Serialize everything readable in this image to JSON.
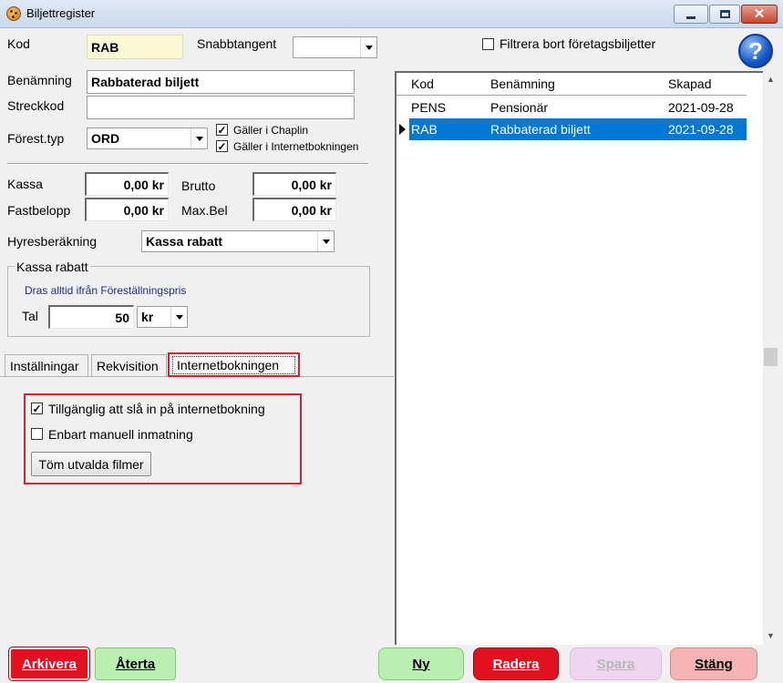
{
  "window": {
    "title": "Biljettregister"
  },
  "form": {
    "kod_label": "Kod",
    "kod_value": "RAB",
    "snabbtangent_label": "Snabbtangent",
    "snabbtangent_value": "",
    "filter_label": "Filtrera bort företagsbiljetter",
    "benamning_label": "Benämning",
    "benamning_value": "Rabbaterad biljett",
    "streckkod_label": "Streckkod",
    "streckkod_value": "",
    "forest_typ_label": "Förest.typ",
    "forest_typ_value": "ORD",
    "galler_chaplin_label": "Gäller i Chaplin",
    "galler_internet_label": "Gäller i Internetbokningen",
    "kassa_label": "Kassa",
    "kassa_value": "0,00 kr",
    "brutto_label": "Brutto",
    "brutto_value": "0,00 kr",
    "fastbelopp_label": "Fastbelopp",
    "fastbelopp_value": "0,00 kr",
    "maxbel_label": "Max.Bel",
    "maxbel_value": "0,00 kr",
    "hyresberakning_label": "Hyresberäkning",
    "hyresberakning_value": "Kassa rabatt",
    "group_title": "Kassa rabatt",
    "group_note": "Dras alltid ifrån Föreställningspris",
    "tal_label": "Tal",
    "tal_value": "50",
    "tal_unit": "kr"
  },
  "tabs": [
    {
      "label": "Inställningar"
    },
    {
      "label": "Rekvisition"
    },
    {
      "label": "Internetbokningen"
    }
  ],
  "internet_tab": {
    "tillganglig_label": "Tillgänglig att slå in på internetbokning",
    "manuell_label": "Enbart manuell inmatning",
    "tom_button": "Töm utvalda filmer"
  },
  "grid": {
    "headers": [
      "Kod",
      "Benämning",
      "Skapad"
    ],
    "rows": [
      {
        "kod": "PENS",
        "benamning": "Pensionär",
        "skapad": "2021-09-28"
      },
      {
        "kod": "RAB",
        "benamning": "Rabbaterad biljett",
        "skapad": "2021-09-28"
      }
    ]
  },
  "buttons": {
    "arkivera": "Arkivera",
    "aterta": "Återta",
    "ny": "Ny",
    "radera": "Radera",
    "spara": "Spara",
    "stang": "Stäng"
  },
  "colors": {
    "selection": "#0078d7",
    "highlight_frame": "#cf2236",
    "red_button": "#e3111f",
    "green_button": "#b8f0b0"
  }
}
